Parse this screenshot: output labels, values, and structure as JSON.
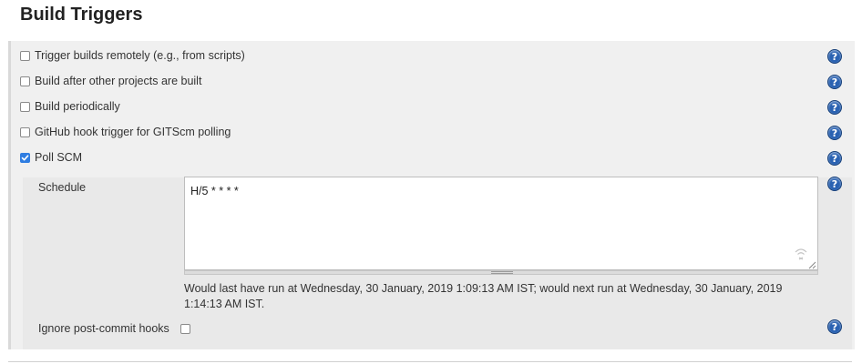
{
  "section": {
    "title": "Build Triggers"
  },
  "triggers": [
    {
      "label": "Trigger builds remotely (e.g., from scripts)",
      "checked": false
    },
    {
      "label": "Build after other projects are built",
      "checked": false
    },
    {
      "label": "Build periodically",
      "checked": false
    },
    {
      "label": "GitHub hook trigger for GITScm polling",
      "checked": false
    },
    {
      "label": "Poll SCM",
      "checked": true
    }
  ],
  "poll_scm": {
    "schedule_label": "Schedule",
    "schedule_value": "H/5 * * * *",
    "run_info": "Would last have run at Wednesday, 30 January, 2019 1:09:13 AM IST; would next run at Wednesday, 30 January, 2019 1:14:13 AM IST.",
    "ignore_label": "Ignore post-commit hooks",
    "ignore_checked": false
  },
  "help": {
    "glyph": "?",
    "color": "#2a62b2"
  },
  "colors": {
    "checkbox_checked": "#2f7de1"
  }
}
